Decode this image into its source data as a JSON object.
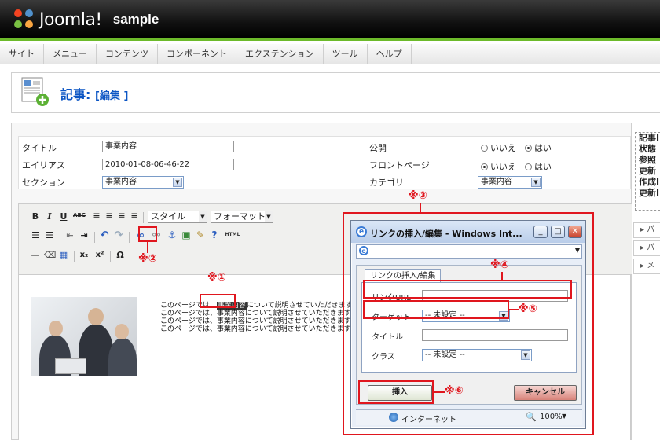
{
  "header": {
    "logo_text": "Joomla!",
    "site_name": "sample"
  },
  "menu": [
    "サイト",
    "メニュー",
    "コンテンツ",
    "コンポーネント",
    "エクステンション",
    "ツール",
    "ヘルプ"
  ],
  "page": {
    "title": "記事:",
    "subtitle": "[編集 ]"
  },
  "fields": {
    "title_label": "タイトル",
    "title_value": "事業内容",
    "alias_label": "エイリアス",
    "alias_value": "2010-01-08-06-46-22",
    "section_label": "セクション",
    "section_value": "事業内容",
    "published_label": "公開",
    "frontpage_label": "フロントページ",
    "category_label": "カテゴリ",
    "category_value": "事業内容",
    "no_label": "いいえ",
    "yes_label": "はい"
  },
  "editor": {
    "style_select": "スタイル",
    "format_select": "フォーマット",
    "line1_pre": "このページでは、",
    "line1_hl": "事業内容",
    "line1_post": "について説明させていただきます。",
    "line_pre": "このページでは、",
    "line_mid": "事業内容",
    "line_post": "について説明させていただきます。",
    "html_label": "HTML"
  },
  "sidebar": {
    "lines": [
      "記事I",
      "状態",
      "参照",
      "更新",
      "作成I",
      "更新I"
    ],
    "buttons": [
      "パ",
      "パ",
      "メ"
    ]
  },
  "dialog": {
    "title": "リンクの挿入/編集 - Windows Int...",
    "tab": "リンクの挿入/編集",
    "url_label": "リンクURL",
    "url_value": "",
    "target_label": "ターゲット",
    "target_value": "-- 未設定 --",
    "title_label": "タイトル",
    "title_value": "",
    "class_label": "クラス",
    "class_value": "-- 未設定 --",
    "insert_button": "挿入",
    "cancel_button": "キャンセル",
    "status_zone": "インターネット",
    "zoom": "100%"
  },
  "annotations": {
    "n1": "※①",
    "n2": "※②",
    "n3": "※③",
    "n4": "※④",
    "n5": "※⑤",
    "n6": "※⑥"
  },
  "colors": {
    "accent": "#6cba2a",
    "link": "#0b55c4",
    "annotation": "#e0161e"
  }
}
